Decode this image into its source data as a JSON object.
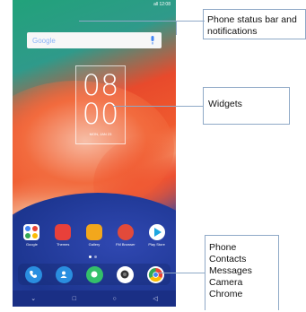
{
  "status_bar": {
    "text": "all 12:08"
  },
  "search": {
    "logo": "Google"
  },
  "clock": {
    "hours": "08",
    "minutes": "00",
    "date": "MON, JAN 23"
  },
  "apps": [
    {
      "name": "Google",
      "color": "#4a5cc0"
    },
    {
      "name": "Themes",
      "color": "#e8403a"
    },
    {
      "name": "Gallery",
      "color": "#f2a71c"
    },
    {
      "name": "FM Browser",
      "color": "#e24a3a"
    },
    {
      "name": "Play Store",
      "color": "#1ea7e1"
    }
  ],
  "dock": [
    {
      "name": "phone-icon",
      "color": "#2a8ee0"
    },
    {
      "name": "contacts-icon",
      "color": "#2a8ee0"
    },
    {
      "name": "messages-icon",
      "color": "#34c06a"
    },
    {
      "name": "camera-icon",
      "color": "#ffffff"
    },
    {
      "name": "chrome-icon",
      "color": "#e8432f"
    }
  ],
  "callouts": {
    "status": "Phone status bar and notifications",
    "widgets": "Widgets",
    "dock_list": [
      "Phone",
      "Contacts",
      "Messages",
      "Camera",
      "Chrome"
    ]
  }
}
